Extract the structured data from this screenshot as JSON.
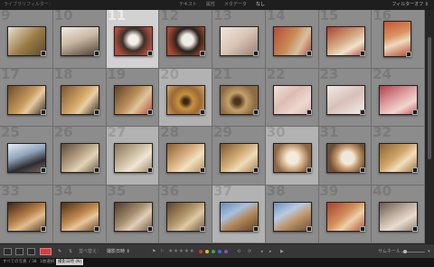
{
  "filterbar": {
    "title": "ライブラリフィルター：",
    "tabs": [
      "テキスト",
      "属性",
      "メタデータ",
      "なし"
    ],
    "active_tab": 3,
    "preset": "フィルターオフ ⇕"
  },
  "grid": {
    "rows": [
      [
        {
          "num": "9",
          "bg": "linear-gradient(135deg,#e8e0d0,#9a7a44 55%,#5a4a30)",
          "state": ""
        },
        {
          "num": "10",
          "bg": "linear-gradient(160deg,#f1ece4,#cbb9a4 45%,#4d3e32)",
          "state": ""
        },
        {
          "num": "11",
          "bg": "radial-gradient(circle at 50% 45%,#f4efe8 20%,#3b2f28 45%,#b24d3d 80%)",
          "state": "sel"
        },
        {
          "num": "12",
          "bg": "radial-gradient(circle at 55% 45%,#f0ebe4 22%,#2a221d 45%,#a8482f 80%)",
          "state": ""
        },
        {
          "num": "13",
          "bg": "linear-gradient(140deg,#f0e6dc,#d8c4b4 50%,#9a7f70)",
          "state": ""
        },
        {
          "num": "14",
          "bg": "linear-gradient(120deg,#b84a3a,#c78a55 45%,#d9c0a0 70%,#b04a3c)",
          "state": ""
        },
        {
          "num": "15",
          "bg": "linear-gradient(150deg,#a9432f,#d7b08a 50%,#f0e3cc 70%,#b5503a)",
          "state": ""
        },
        {
          "num": "16",
          "bg": "linear-gradient(160deg,#c9552f,#d99466 40%,#eed9c0 60%,#b24a2c)",
          "state": "",
          "tall": true
        }
      ],
      [
        {
          "num": "17",
          "bg": "linear-gradient(130deg,#6b4a2c,#c99b5e 50%,#e7cba2 65%,#3b2a1b)",
          "state": ""
        },
        {
          "num": "18",
          "bg": "linear-gradient(130deg,#7a5431,#d7aa6a 50%,#e9cfa7 65%,#3a2919)",
          "state": ""
        },
        {
          "num": "19",
          "bg": "linear-gradient(130deg,#5d4129,#b98d58 45%,#dfc59d 65%,#b34b35)",
          "state": ""
        },
        {
          "num": "20",
          "bg": "radial-gradient(circle at 50% 55%,#3b2615 10%,#c8903f 30%,#9a6a35 60%,#d2a56a)",
          "state": "hi"
        },
        {
          "num": "21",
          "bg": "radial-gradient(circle at 45% 55%,#4a3520 12%,#c5a068 35%,#8c6b44 70%)",
          "state": ""
        },
        {
          "num": "22",
          "bg": "linear-gradient(140deg,#f1e2db,#dcbcb2 40%,#efd7cf 70%,#d9b7a9)",
          "state": ""
        },
        {
          "num": "23",
          "bg": "linear-gradient(150deg,#f2eae6,#d7c0b8 50%,#f4ece9)",
          "state": ""
        },
        {
          "num": "24",
          "bg": "linear-gradient(150deg,#b5404a,#dfa3a3 45%,#f1d6d0 70%,#c45860)",
          "state": ""
        }
      ],
      [
        {
          "num": "25",
          "bg": "linear-gradient(160deg,#e6ecf2,#90a6bd 40%,#2d2c30 70%,#7a6a60)",
          "state": ""
        },
        {
          "num": "26",
          "bg": "linear-gradient(140deg,#5a4a39,#b9a487 45%,#e3d4b6 65%,#6a5642)",
          "state": ""
        },
        {
          "num": "27",
          "bg": "linear-gradient(140deg,#8a7153,#cfc0a5 45%,#f0e6d2 65%,#9a8567)",
          "state": "hi"
        },
        {
          "num": "28",
          "bg": "linear-gradient(140deg,#8a5d33,#dcb283 45%,#f2e1c2 65%,#b58b5b)",
          "state": ""
        },
        {
          "num": "29",
          "bg": "linear-gradient(140deg,#7d5631,#d2ad77 45%,#efdcb8 65%,#a57c4d)",
          "state": ""
        },
        {
          "num": "30",
          "bg": "radial-gradient(circle at 50% 50%,#f3e9dc 25%,#d9b48d 45%,#8b6849 75%)",
          "state": "hi"
        },
        {
          "num": "31",
          "bg": "radial-gradient(circle at 55% 50%,#f0e7dc 25%,#c89b6c 45%,#6d5036 75%)",
          "state": ""
        },
        {
          "num": "32",
          "bg": "linear-gradient(140deg,#8b6234,#d1a56b 45%,#f2dfbd 65%,#9a6f3e)",
          "state": ""
        }
      ],
      [
        {
          "num": "33",
          "bg": "linear-gradient(150deg,#3a2617,#b57e47 45%,#e4bd8d 65%,#5a3c22)",
          "state": ""
        },
        {
          "num": "34",
          "bg": "linear-gradient(150deg,#4a3019,#bd864d 45%,#eac697 65%,#604127)",
          "state": ""
        },
        {
          "num": "35",
          "bg": "linear-gradient(140deg,#4a3a2c,#a88f73 45%,#e2cfb6 65%,#6b5744)",
          "state": ""
        },
        {
          "num": "36",
          "bg": "linear-gradient(140deg,#59432d,#b2956b 45%,#dfc9a4 65%,#6d5339)",
          "state": ""
        },
        {
          "num": "37",
          "bg": "linear-gradient(150deg,#6a8bb5,#a9c0dc 35%,#b28556 60%,#5a3e25)",
          "state": "hi"
        },
        {
          "num": "38",
          "bg": "linear-gradient(150deg,#6f91ba,#b7cbe2 35%,#c0966a 60%,#6b4c2f)",
          "state": ""
        },
        {
          "num": "39",
          "bg": "linear-gradient(140deg,#a5412d,#d48e5c 45%,#efd0aa 65%,#b04c30)",
          "state": ""
        },
        {
          "num": "40",
          "bg": "linear-gradient(150deg,#6a5a50,#c7b6a6 45%,#e9ddd0 65%,#8d7b6d)",
          "state": ""
        }
      ]
    ]
  },
  "toolbar": {
    "sort_label": "並べ替え：",
    "sort_value": "撮影日時 ⇕",
    "stars": "★★★★★",
    "thumbnail_label": "サムネール"
  },
  "colors": {
    "label_red": "#d23a2f",
    "label_yellow": "#d6c32b",
    "label_green": "#3fa64a",
    "label_blue": "#3a6ed6",
    "label_purple": "#8e4ab8"
  },
  "status": {
    "library": "すべての写真",
    "count": "1枚選択",
    "folder": "/ 38",
    "pill": "撮影日時 (N)"
  }
}
